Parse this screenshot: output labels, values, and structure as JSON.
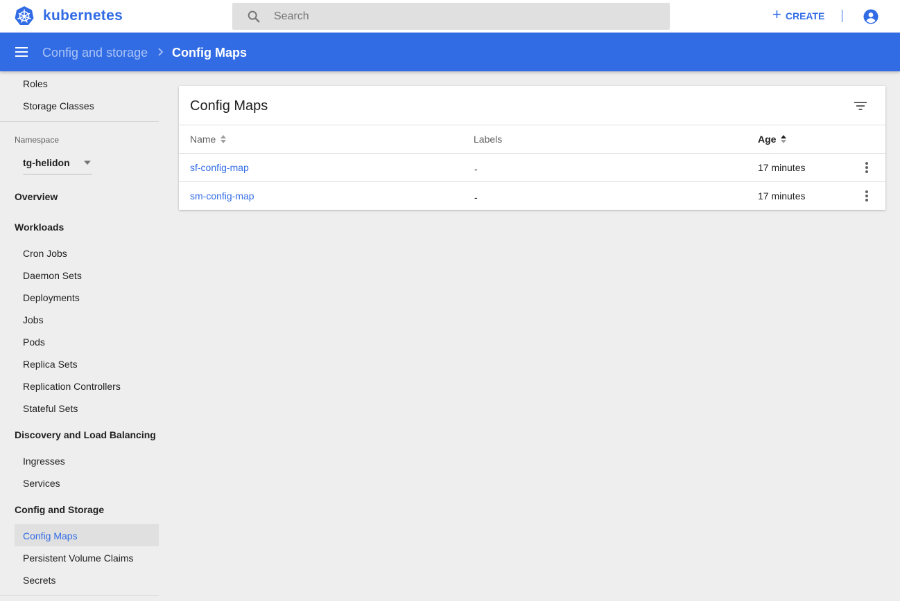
{
  "topbar": {
    "brand": "kubernetes",
    "search_placeholder": "Search",
    "create_label": "CREATE"
  },
  "header": {
    "breadcrumb_parent": "Config and storage",
    "breadcrumb_current": "Config Maps"
  },
  "sidebar": {
    "top_items": [
      "Roles",
      "Storage Classes"
    ],
    "namespace_label": "Namespace",
    "namespace_value": "tg-helidon",
    "overview": "Overview",
    "workloads": {
      "title": "Workloads",
      "items": [
        "Cron Jobs",
        "Daemon Sets",
        "Deployments",
        "Jobs",
        "Pods",
        "Replica Sets",
        "Replication Controllers",
        "Stateful Sets"
      ]
    },
    "discovery": {
      "title": "Discovery and Load Balancing",
      "items": [
        "Ingresses",
        "Services"
      ]
    },
    "config": {
      "title": "Config and Storage",
      "items": [
        "Config Maps",
        "Persistent Volume Claims",
        "Secrets"
      ],
      "active": "Config Maps"
    }
  },
  "card": {
    "title": "Config Maps",
    "columns": {
      "name": "Name",
      "labels": "Labels",
      "age": "Age"
    },
    "sorted_by": "Age",
    "rows": [
      {
        "name": "sf-config-map",
        "labels": "-",
        "age": "17 minutes"
      },
      {
        "name": "sm-config-map",
        "labels": "-",
        "age": "17 minutes"
      }
    ]
  },
  "colors": {
    "accent": "#326ce5",
    "background": "#eeeeee",
    "active_item_bg": "#e0e0e0"
  }
}
